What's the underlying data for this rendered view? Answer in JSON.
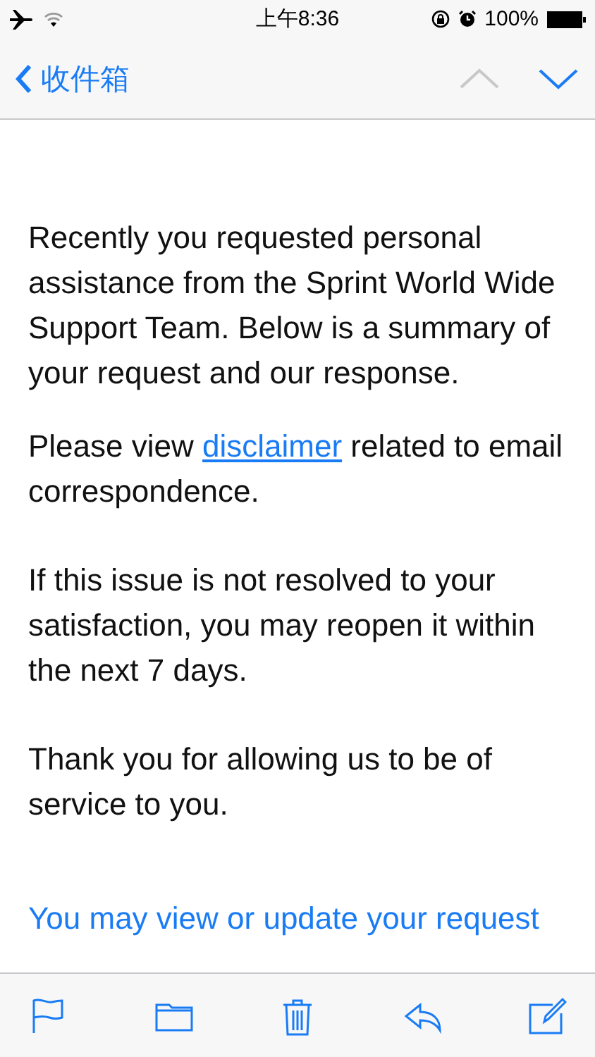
{
  "status_bar": {
    "time": "上午8:36",
    "battery": "100%"
  },
  "nav": {
    "back_label": "收件箱",
    "previous": {
      "disabled": true
    },
    "next": {
      "disabled": false
    }
  },
  "message": {
    "paragraphs": [
      [
        {
          "kind": "text",
          "text": "Recently you requested personal assistance from the Sprint World Wide Support Team. Below is a summary of your request and our response."
        }
      ],
      [
        {
          "kind": "text",
          "text": "Please view "
        },
        {
          "kind": "link",
          "text": "disclaimer"
        },
        {
          "kind": "text",
          "text": " related to email correspondence."
        }
      ],
      [
        {
          "kind": "text",
          "text": "If this issue is not resolved to your satisfaction, you may reopen it within the next 7 days."
        }
      ],
      [
        {
          "kind": "text",
          "text": "Thank you for allowing us to be of service to you."
        }
      ]
    ],
    "footer_link": "You may view or update your request"
  },
  "toolbar": [
    {
      "kind": "flag"
    },
    {
      "kind": "folder"
    },
    {
      "kind": "trash"
    },
    {
      "kind": "reply"
    },
    {
      "kind": "compose"
    }
  ]
}
